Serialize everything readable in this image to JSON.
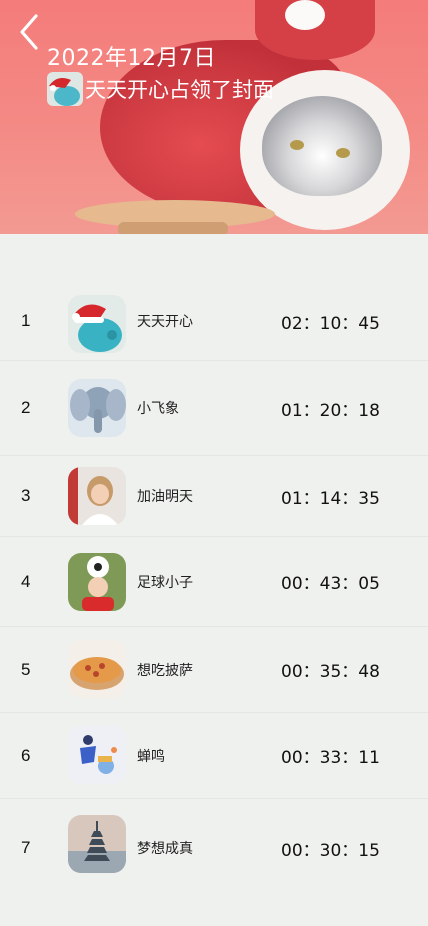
{
  "header": {
    "date": "2022年12月7日",
    "headline": "天天开心占领了封面",
    "back_icon": "chevron-left-icon"
  },
  "rankings": [
    {
      "rank": "1",
      "name": "天天开心",
      "time": "02：10：45",
      "avatar": "piggy-santa-avatar"
    },
    {
      "rank": "2",
      "name": "小飞象",
      "time": "01：20：18",
      "avatar": "elephant-avatar"
    },
    {
      "rank": "3",
      "name": "加油明天",
      "time": "01：14：35",
      "avatar": "girl-avatar"
    },
    {
      "rank": "4",
      "name": "足球小子",
      "time": "00：43：05",
      "avatar": "soccer-boy-avatar"
    },
    {
      "rank": "5",
      "name": "想吃披萨",
      "time": "00：35：48",
      "avatar": "pizza-avatar"
    },
    {
      "rank": "6",
      "name": "蝉鸣",
      "time": "00：33：11",
      "avatar": "illustration-avatar"
    },
    {
      "rank": "7",
      "name": "梦想成真",
      "time": "00：30：15",
      "avatar": "pagoda-avatar"
    }
  ]
}
